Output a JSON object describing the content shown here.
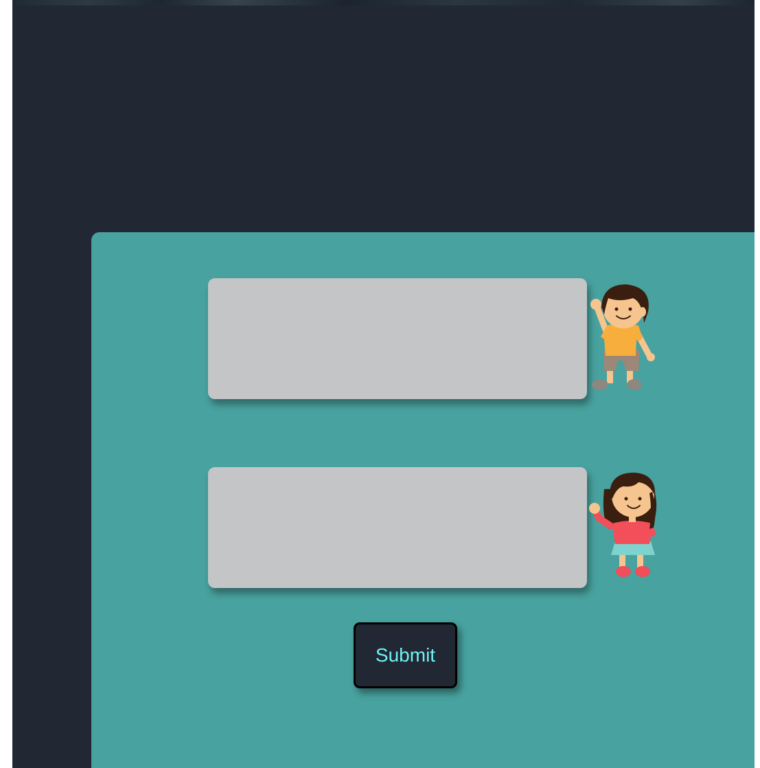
{
  "form": {
    "field_1": {
      "value": "",
      "placeholder": ""
    },
    "field_2": {
      "value": "",
      "placeholder": ""
    },
    "submit_label": "Submit"
  },
  "icons": {
    "boy": "waving-boy-icon",
    "girl": "waving-girl-icon"
  },
  "colors": {
    "page_background": "#212834",
    "card_background": "#48a29f",
    "field_background": "#c4c5c7",
    "button_background": "#212834",
    "button_text": "#6ff2f2"
  }
}
